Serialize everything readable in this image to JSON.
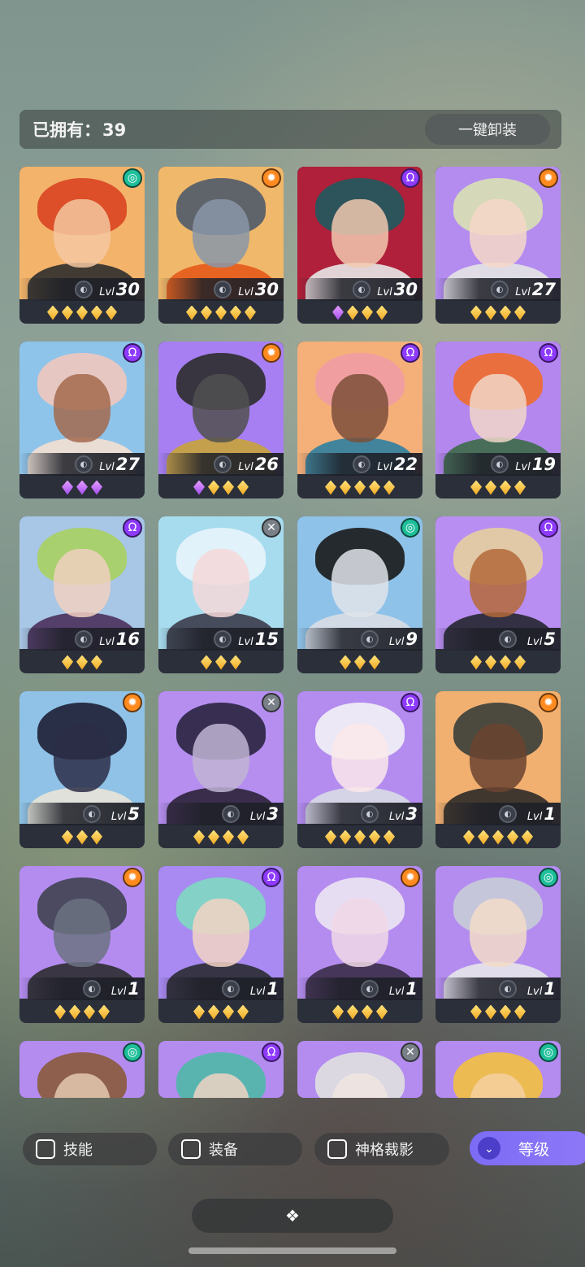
{
  "header": {
    "owned_label": "已拥有：",
    "owned_count": "39",
    "unequip_all_label": "一键卸装"
  },
  "level_prefix": "Lvl",
  "faction_icons": {
    "green": "spiral-icon",
    "orange": "sun-gear-icon",
    "purple": "horned-icon",
    "white": "cross-icon"
  },
  "colors": {
    "green": "#1fbf9b",
    "orange": "#ff8a1f",
    "purple": "#8e3bff",
    "white": "#7a8088",
    "accent": "#7c6cf5"
  },
  "heroes": [
    {
      "level": "30",
      "faction": "green",
      "stars": [
        "g",
        "g",
        "g",
        "g",
        "g"
      ],
      "bg": "#f3b36b",
      "hair": "#d94422",
      "face": "#f4c7a0",
      "body": "#2e2e2e"
    },
    {
      "level": "30",
      "faction": "orange",
      "stars": [
        "g",
        "g",
        "g",
        "g",
        "g"
      ],
      "bg": "#f0b86a",
      "hair": "#4f5b6b",
      "face": "#8a96a8",
      "body": "#e65a1a"
    },
    {
      "level": "30",
      "faction": "purple",
      "stars": [
        "p",
        "g",
        "g",
        "g"
      ],
      "bg": "#b0203a",
      "hair": "#1f5a5e",
      "face": "#f2c9b0",
      "body": "#e8e8e8"
    },
    {
      "level": "27",
      "faction": "orange",
      "stars": [
        "g",
        "g",
        "g",
        "g"
      ],
      "bg": "#b48cf0",
      "hair": "#d8e0b2",
      "face": "#f6d8c8",
      "body": "#e4e4e4"
    },
    {
      "level": "27",
      "faction": "purple",
      "stars": [
        "p",
        "p",
        "p"
      ],
      "bg": "#8fc4ea",
      "hair": "#f0c8bc",
      "face": "#a36a4e",
      "body": "#f3e0d2"
    },
    {
      "level": "26",
      "faction": "orange",
      "stars": [
        "p",
        "g",
        "g",
        "g"
      ],
      "bg": "#a77ff2",
      "hair": "#2c2c2c",
      "face": "#505050",
      "body": "#c8a43a"
    },
    {
      "level": "22",
      "faction": "purple",
      "stars": [
        "g",
        "g",
        "g",
        "g",
        "g"
      ],
      "bg": "#f5b07a",
      "hair": "#f19ca4",
      "face": "#7c4f3a",
      "body": "#2f7fa0"
    },
    {
      "level": "19",
      "faction": "purple",
      "stars": [
        "g",
        "g",
        "g",
        "g"
      ],
      "bg": "#b487ef",
      "hair": "#f06d2a",
      "face": "#f1d7c8",
      "body": "#3c6b48"
    },
    {
      "level": "16",
      "faction": "purple",
      "stars": [
        "g",
        "g",
        "g"
      ],
      "bg": "#a8c6e6",
      "hair": "#a8d060",
      "face": "#f0d0c0",
      "body": "#4a2f5c"
    },
    {
      "level": "15",
      "faction": "white",
      "stars": [
        "g",
        "g",
        "g"
      ],
      "bg": "#a7dcef",
      "hair": "#e8f4fb",
      "face": "#f6d8d8",
      "body": "#3c3c4a"
    },
    {
      "level": "9",
      "faction": "green",
      "stars": [
        "g",
        "g",
        "g"
      ],
      "bg": "#8fc2e8",
      "hair": "#1a1a1a",
      "face": "#e0e4ea",
      "body": "#d8dde4"
    },
    {
      "level": "5",
      "faction": "purple",
      "stars": [
        "g",
        "g",
        "g",
        "g"
      ],
      "bg": "#b98ef2",
      "hair": "#e6cfa0",
      "face": "#b36a3a",
      "body": "#262630"
    },
    {
      "level": "5",
      "faction": "orange",
      "stars": [
        "g",
        "g",
        "g"
      ],
      "bg": "#8fc2e6",
      "hair": "#1d1f34",
      "face": "#2b2d46",
      "body": "#e8e4d8"
    },
    {
      "level": "3",
      "faction": "white",
      "stars": [
        "g",
        "g",
        "g",
        "g"
      ],
      "bg": "#b58ef0",
      "hair": "#2a2340",
      "face": "#c0b4d4",
      "body": "#2c2238"
    },
    {
      "level": "3",
      "faction": "purple",
      "stars": [
        "g",
        "g",
        "g",
        "g",
        "g"
      ],
      "bg": "#b48cf0",
      "hair": "#f2f2f6",
      "face": "#fbe8ea",
      "body": "#d8dbe4"
    },
    {
      "level": "1",
      "faction": "orange",
      "stars": [
        "g",
        "g",
        "g",
        "g",
        "g"
      ],
      "bg": "#f2b070",
      "hair": "#3a3f3a",
      "face": "#6b4330",
      "body": "#2c2a28"
    },
    {
      "level": "1",
      "faction": "orange",
      "stars": [
        "g",
        "g",
        "g",
        "g"
      ],
      "bg": "#b48cf0",
      "hair": "#3f4350",
      "face": "#6c7282",
      "body": "#2c2c30"
    },
    {
      "level": "1",
      "faction": "purple",
      "stars": [
        "g",
        "g",
        "g",
        "g"
      ],
      "bg": "#a88af2",
      "hair": "#7ed8c2",
      "face": "#f3d4c4",
      "body": "#2a2a32"
    },
    {
      "level": "1",
      "faction": "orange",
      "stars": [
        "g",
        "g",
        "g",
        "g"
      ],
      "bg": "#b48cf0",
      "hair": "#ece6f2",
      "face": "#f0d8e6",
      "body": "#3a2c48"
    },
    {
      "level": "1",
      "faction": "green",
      "stars": [
        "g",
        "g",
        "g",
        "g"
      ],
      "bg": "#b48cf0",
      "hair": "#c8ccd8",
      "face": "#f2dcc8",
      "body": "#e6e6ea"
    },
    {
      "level": "",
      "faction": "green",
      "stars": [],
      "bg": "#b48cf0",
      "hair": "#8a5a3a",
      "face": "#e4c8b0",
      "body": "#8a5a3a"
    },
    {
      "level": "",
      "faction": "purple",
      "stars": [],
      "bg": "#b48cf0",
      "hair": "#4fb8a8",
      "face": "#f0d4c4",
      "body": "#3a3a44"
    },
    {
      "level": "",
      "faction": "white",
      "stars": [],
      "bg": "#b48cf0",
      "hair": "#e0e0e0",
      "face": "#f0e6e0",
      "body": "#3a3a44"
    },
    {
      "level": "",
      "faction": "green",
      "stars": [],
      "bg": "#b48cf0",
      "hair": "#f2c040",
      "face": "#f4d0a0",
      "body": "#3a3a44"
    }
  ],
  "filters": [
    {
      "label": "技能"
    },
    {
      "label": "装备"
    },
    {
      "label": "神格裁影"
    }
  ],
  "sort_button": {
    "label": "等级",
    "icon": "double-chevron-down-icon"
  },
  "expand_button": {
    "icon": "diamond-cluster-icon"
  }
}
